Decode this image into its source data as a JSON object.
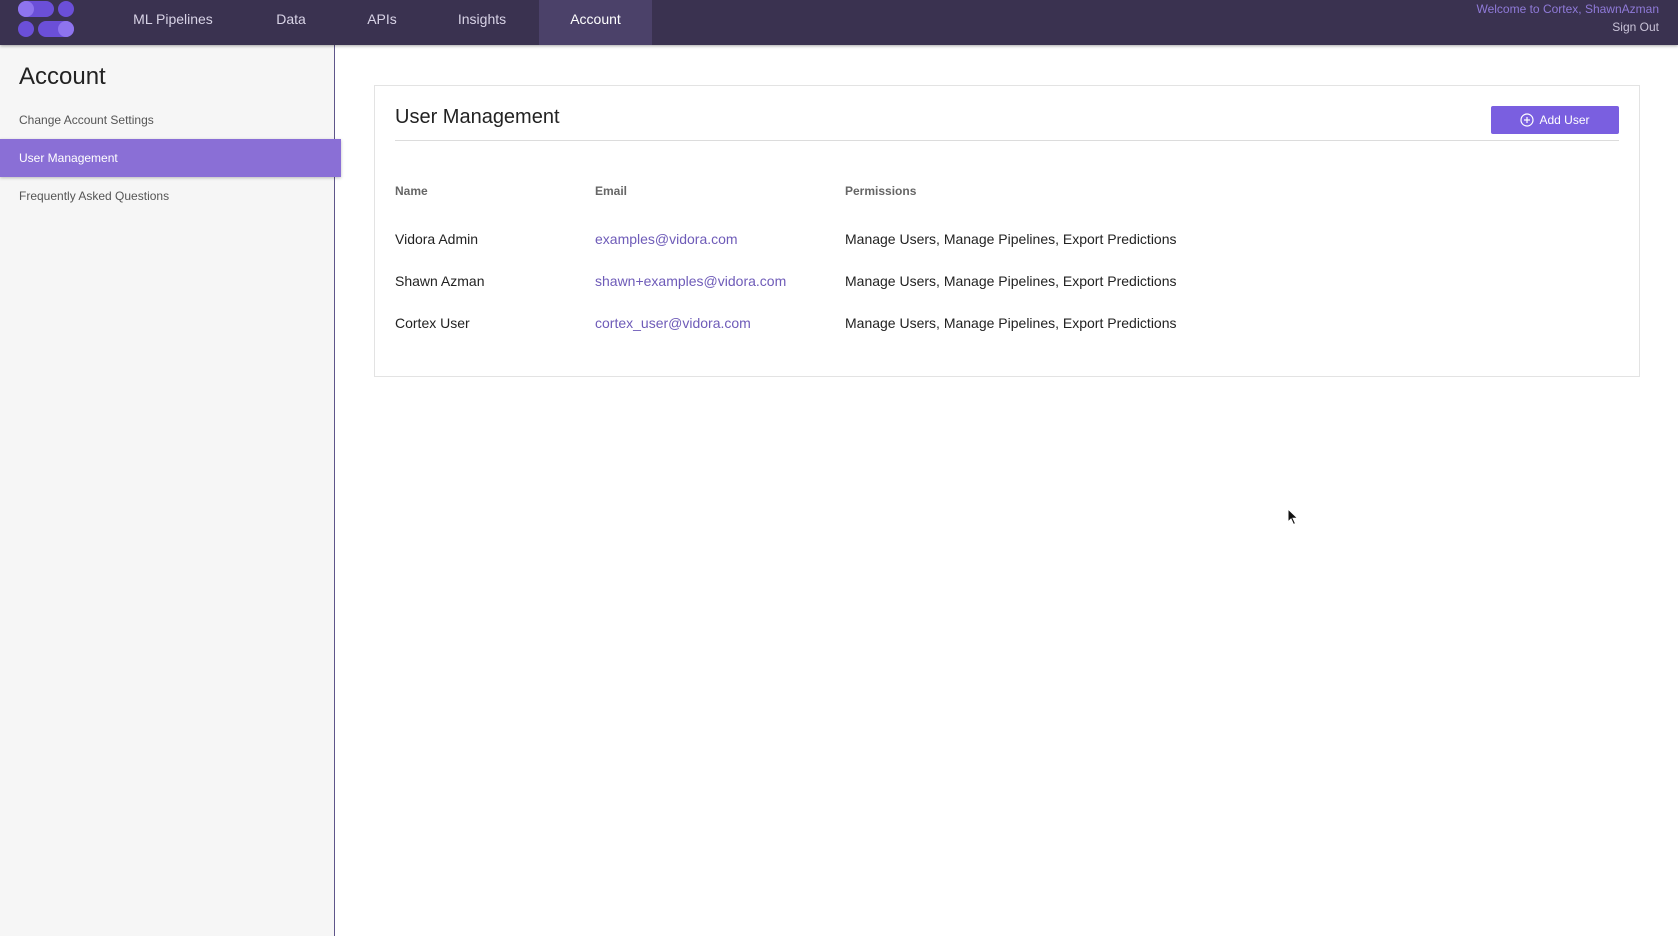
{
  "header": {
    "nav": [
      {
        "label": "ML Pipelines"
      },
      {
        "label": "Data"
      },
      {
        "label": "APIs"
      },
      {
        "label": "Insights"
      },
      {
        "label": "Account",
        "active": true
      }
    ],
    "welcome": "Welcome to Cortex, ShawnAzman",
    "sign_out": "Sign Out"
  },
  "sidebar": {
    "title": "Account",
    "items": [
      {
        "label": "Change Account Settings"
      },
      {
        "label": "User Management",
        "active": true
      },
      {
        "label": "Frequently Asked Questions"
      }
    ]
  },
  "main": {
    "title": "User Management",
    "add_user_label": "Add User",
    "columns": {
      "name": "Name",
      "email": "Email",
      "permissions": "Permissions"
    },
    "rows": [
      {
        "name": "Vidora Admin",
        "email": "examples@vidora.com",
        "permissions": "Manage Users, Manage Pipelines, Export Predictions"
      },
      {
        "name": "Shawn Azman",
        "email": "shawn+examples@vidora.com",
        "permissions": "Manage Users, Manage Pipelines, Export Predictions"
      },
      {
        "name": "Cortex User",
        "email": "cortex_user@vidora.com",
        "permissions": "Manage Users, Manage Pipelines, Export Predictions"
      }
    ]
  },
  "colors": {
    "topbar": "#3a3250",
    "accent": "#7a5fe0",
    "sidebar_active": "#8a6fd6",
    "link": "#6e5bb8"
  },
  "icons": {
    "logo": "cortex-logo",
    "add": "plus-circle-icon",
    "cursor": "mouse-pointer-icon"
  }
}
